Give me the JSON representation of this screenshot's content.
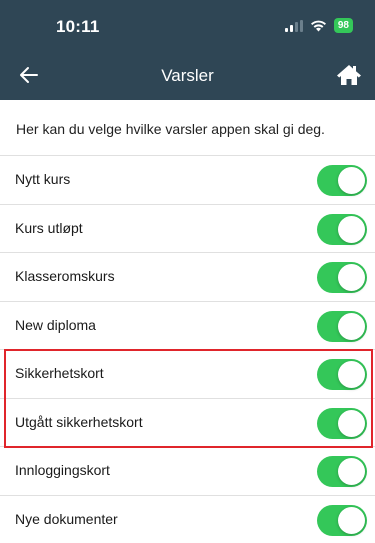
{
  "status_bar": {
    "time": "10:11",
    "battery": "98"
  },
  "nav": {
    "title": "Varsler",
    "back_icon": "arrow-left-icon",
    "home_icon": "home-icon"
  },
  "intro": "Her kan du velge hvilke varsler appen skal gi deg.",
  "settings": [
    {
      "label": "Nytt kurs",
      "enabled": true
    },
    {
      "label": "Kurs utløpt",
      "enabled": true
    },
    {
      "label": "Klasseromskurs",
      "enabled": true
    },
    {
      "label": "New diploma",
      "enabled": true
    },
    {
      "label": "Sikkerhetskort",
      "enabled": true
    },
    {
      "label": "Utgått sikkerhetskort",
      "enabled": true
    },
    {
      "label": "Innloggingskort",
      "enabled": true
    },
    {
      "label": "Nye dokumenter",
      "enabled": true
    }
  ],
  "colors": {
    "header": "#2f4655",
    "toggle_on": "#34c759",
    "highlight": "#e0252b"
  }
}
